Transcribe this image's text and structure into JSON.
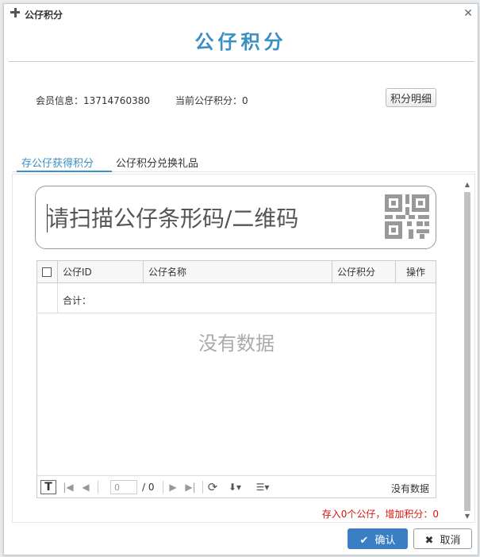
{
  "window": {
    "title": "公仔积分"
  },
  "heading": "公仔积分",
  "member": {
    "info_label": "会员信息：13714760380",
    "points_label": "当前公仔积分：0"
  },
  "detail_button": "积分明细",
  "tabs": [
    {
      "label": "存公仔获得积分",
      "active": true
    },
    {
      "label": "公仔积分兑换礼品",
      "active": false
    }
  ],
  "scan": {
    "placeholder": "请扫描公仔条形码/二维码"
  },
  "table": {
    "columns": [
      "公仔ID",
      "公仔名称",
      "公仔积分",
      "操作"
    ],
    "summary_label": "合计：",
    "empty_text": "没有数据"
  },
  "pager": {
    "page_value": "0",
    "total": "/ 0",
    "status": "没有数据"
  },
  "stat_text": "存入0个公仔，增加积分：0",
  "buttons": {
    "confirm": "确认",
    "cancel": "取消"
  },
  "colors": {
    "accent": "#3a8fc4",
    "warning": "#d9140e"
  }
}
